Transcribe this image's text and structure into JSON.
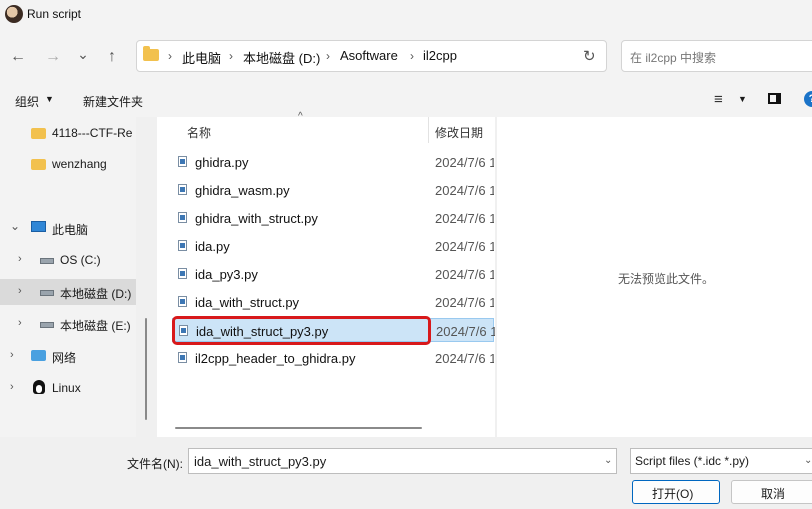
{
  "window": {
    "title": "Run script"
  },
  "nav": {
    "back": "←",
    "forward": "→",
    "recent": "⌄",
    "up": "↑",
    "refresh": "↻",
    "breadcrumb": [
      "此电脑",
      "本地磁盘 (D:)",
      "Asoftware",
      "il2cpp"
    ],
    "separator": "›",
    "search_placeholder": "在 il2cpp 中搜索"
  },
  "toolbar": {
    "organize": "组织",
    "new_folder": "新建文件夹",
    "caret": "▼",
    "view_icon": "≡",
    "help": "?"
  },
  "sidebar": {
    "chevron_right": "›",
    "chevron_down": "⌄",
    "items": [
      {
        "label": "4118---CTF-Re"
      },
      {
        "label": "wenzhang"
      },
      {
        "label": "此电脑"
      },
      {
        "label": "OS (C:)"
      },
      {
        "label": "本地磁盘 (D:)"
      },
      {
        "label": "本地磁盘 (E:)"
      },
      {
        "label": "网络"
      },
      {
        "label": "Linux"
      }
    ]
  },
  "filelist": {
    "sort_arrow": "^",
    "columns": {
      "name": "名称",
      "date": "修改日期"
    },
    "files": [
      {
        "name": "ghidra.py",
        "date": "2024/7/6 1"
      },
      {
        "name": "ghidra_wasm.py",
        "date": "2024/7/6 1"
      },
      {
        "name": "ghidra_with_struct.py",
        "date": "2024/7/6 1"
      },
      {
        "name": "ida.py",
        "date": "2024/7/6 1"
      },
      {
        "name": "ida_py3.py",
        "date": "2024/7/6 1"
      },
      {
        "name": "ida_with_struct.py",
        "date": "2024/7/6 1"
      },
      {
        "name": "ida_with_struct_py3.py",
        "date": "2024/7/6 1"
      },
      {
        "name": "il2cpp_header_to_ghidra.py",
        "date": "2024/7/6 1"
      }
    ],
    "selected_index": 6
  },
  "preview": {
    "message": "无法预览此文件。"
  },
  "bottom": {
    "filename_label": "文件名(N):",
    "filename_value": "ida_with_struct_py3.py",
    "filter_value": "Script files (*.idc *.py)",
    "caret": "⌄",
    "open_label": "打开(O)",
    "cancel_label": "取消"
  },
  "colors": {
    "accent": "#0067c0",
    "selection": "#cce4f7",
    "highlight": "#d8191b",
    "folder": "#f2c14e"
  }
}
